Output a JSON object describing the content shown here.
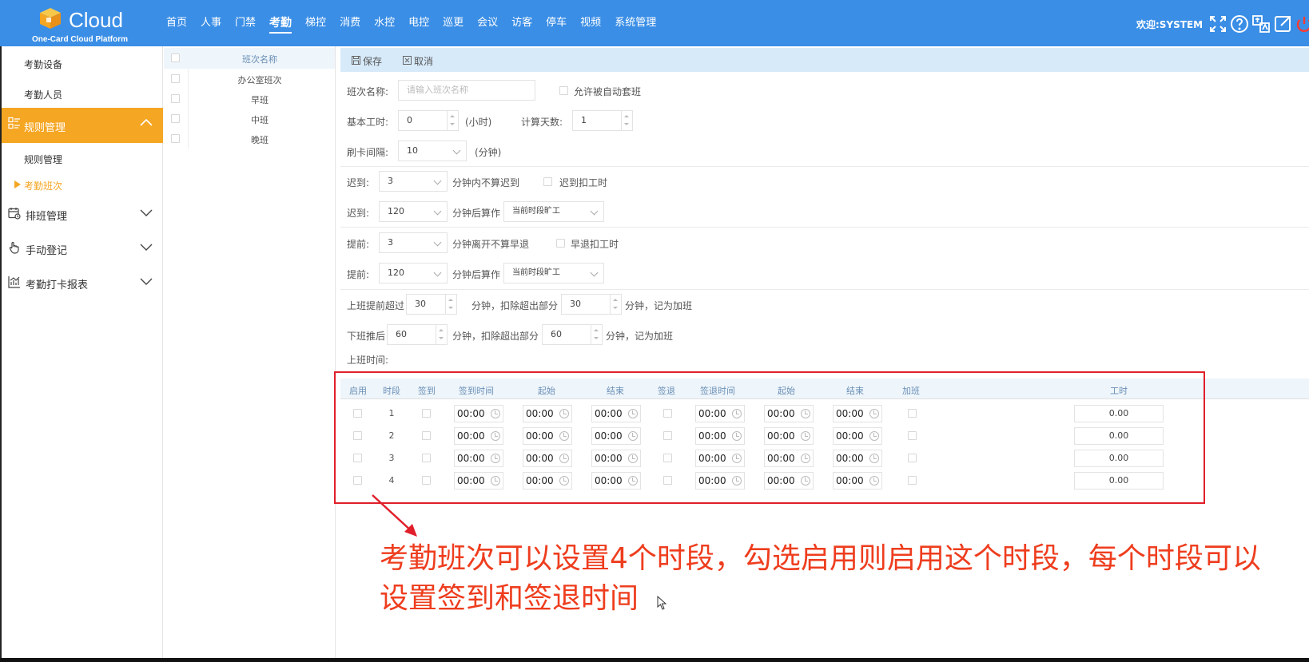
{
  "brand": {
    "title": "Cloud",
    "subtitle": "One-Card Cloud Platform"
  },
  "nav": [
    "首页",
    "人事",
    "门禁",
    "考勤",
    "梯控",
    "消费",
    "水控",
    "电控",
    "巡更",
    "会议",
    "访客",
    "停车",
    "视频",
    "系统管理"
  ],
  "nav_active": "考勤",
  "welcome": "欢迎:SYSTEM",
  "top_icons": [
    "fullscreen-icon",
    "help-icon",
    "translate-icon",
    "external-link-icon",
    "power-icon"
  ],
  "sidebar": {
    "device": "考勤设备",
    "people": "考勤人员",
    "rules_group": "规则管理",
    "rules_item": "规则管理",
    "shift_item": "考勤班次",
    "schedule_group": "排班管理",
    "manual_group": "手动登记",
    "report_group": "考勤打卡报表"
  },
  "shift_list": {
    "header": "班次名称",
    "items": [
      "办公室班次",
      "早班",
      "中班",
      "晚班"
    ]
  },
  "toolbar": {
    "save": "保存",
    "cancel": "取消"
  },
  "form": {
    "shift_name_label": "班次名称:",
    "shift_name_placeholder": "请输入班次名称",
    "auto_match_label": "允许被自动套班",
    "base_hours_label": "基本工时:",
    "base_hours_value": "0",
    "base_hours_unit": "(小时)",
    "calc_days_label": "计算天数:",
    "calc_days_value": "1",
    "card_interval_label": "刷卡间隔:",
    "card_interval_value": "10",
    "card_interval_unit": "(分钟)",
    "late1_label": "迟到:",
    "late1_value": "3",
    "late1_text": "分钟内不算迟到",
    "late_deduct_label": "迟到扣工时",
    "late2_label": "迟到:",
    "late2_value": "120",
    "late2_text": "分钟后算作",
    "late2_select": "当前时段旷工",
    "early1_label": "提前:",
    "early1_value": "3",
    "early1_text": "分钟离开不算早退",
    "early_deduct_label": "早退扣工时",
    "early2_label": "提前:",
    "early2_value": "120",
    "early2_text": "分钟后算作",
    "early2_select": "当前时段旷工",
    "ot_before_label": "上班提前超过",
    "ot_before_value": "30",
    "ot_before_text": "分钟，扣除超出部分",
    "ot_before_value2": "30",
    "ot_before_suffix": "分钟，记为加班",
    "ot_after_label": "下班推后",
    "ot_after_value": "60",
    "ot_after_text": "分钟，扣除超出部分",
    "ot_after_value2": "60",
    "ot_after_suffix": "分钟，记为加班",
    "work_time_label": "上班时间:"
  },
  "schedule": {
    "headers": [
      "启用",
      "时段",
      "签到",
      "签到时间",
      "起始",
      "结束",
      "签退",
      "签退时间",
      "起始",
      "结束",
      "加班",
      "工时"
    ],
    "rows": [
      {
        "seg": "1",
        "in": "00:00",
        "in_start": "00:00",
        "in_end": "00:00",
        "out": "00:00",
        "out_start": "00:00",
        "out_end": "00:00",
        "hours": "0.00"
      },
      {
        "seg": "2",
        "in": "00:00",
        "in_start": "00:00",
        "in_end": "00:00",
        "out": "00:00",
        "out_start": "00:00",
        "out_end": "00:00",
        "hours": "0.00"
      },
      {
        "seg": "3",
        "in": "00:00",
        "in_start": "00:00",
        "in_end": "00:00",
        "out": "00:00",
        "out_start": "00:00",
        "out_end": "00:00",
        "hours": "0.00"
      },
      {
        "seg": "4",
        "in": "00:00",
        "in_start": "00:00",
        "in_end": "00:00",
        "out": "00:00",
        "out_start": "00:00",
        "out_end": "00:00",
        "hours": "0.00"
      }
    ]
  },
  "annotation": {
    "line1": "考勤班次可以设置4个时段，勾选启用则启用这个时段，每个时段可以",
    "line2": "设置签到和签退时间"
  },
  "colors": {
    "topbar": "#3a8ee6",
    "active": "#f5a623",
    "highlight": "#e01f2a",
    "annotation": "#ee3d1e"
  }
}
